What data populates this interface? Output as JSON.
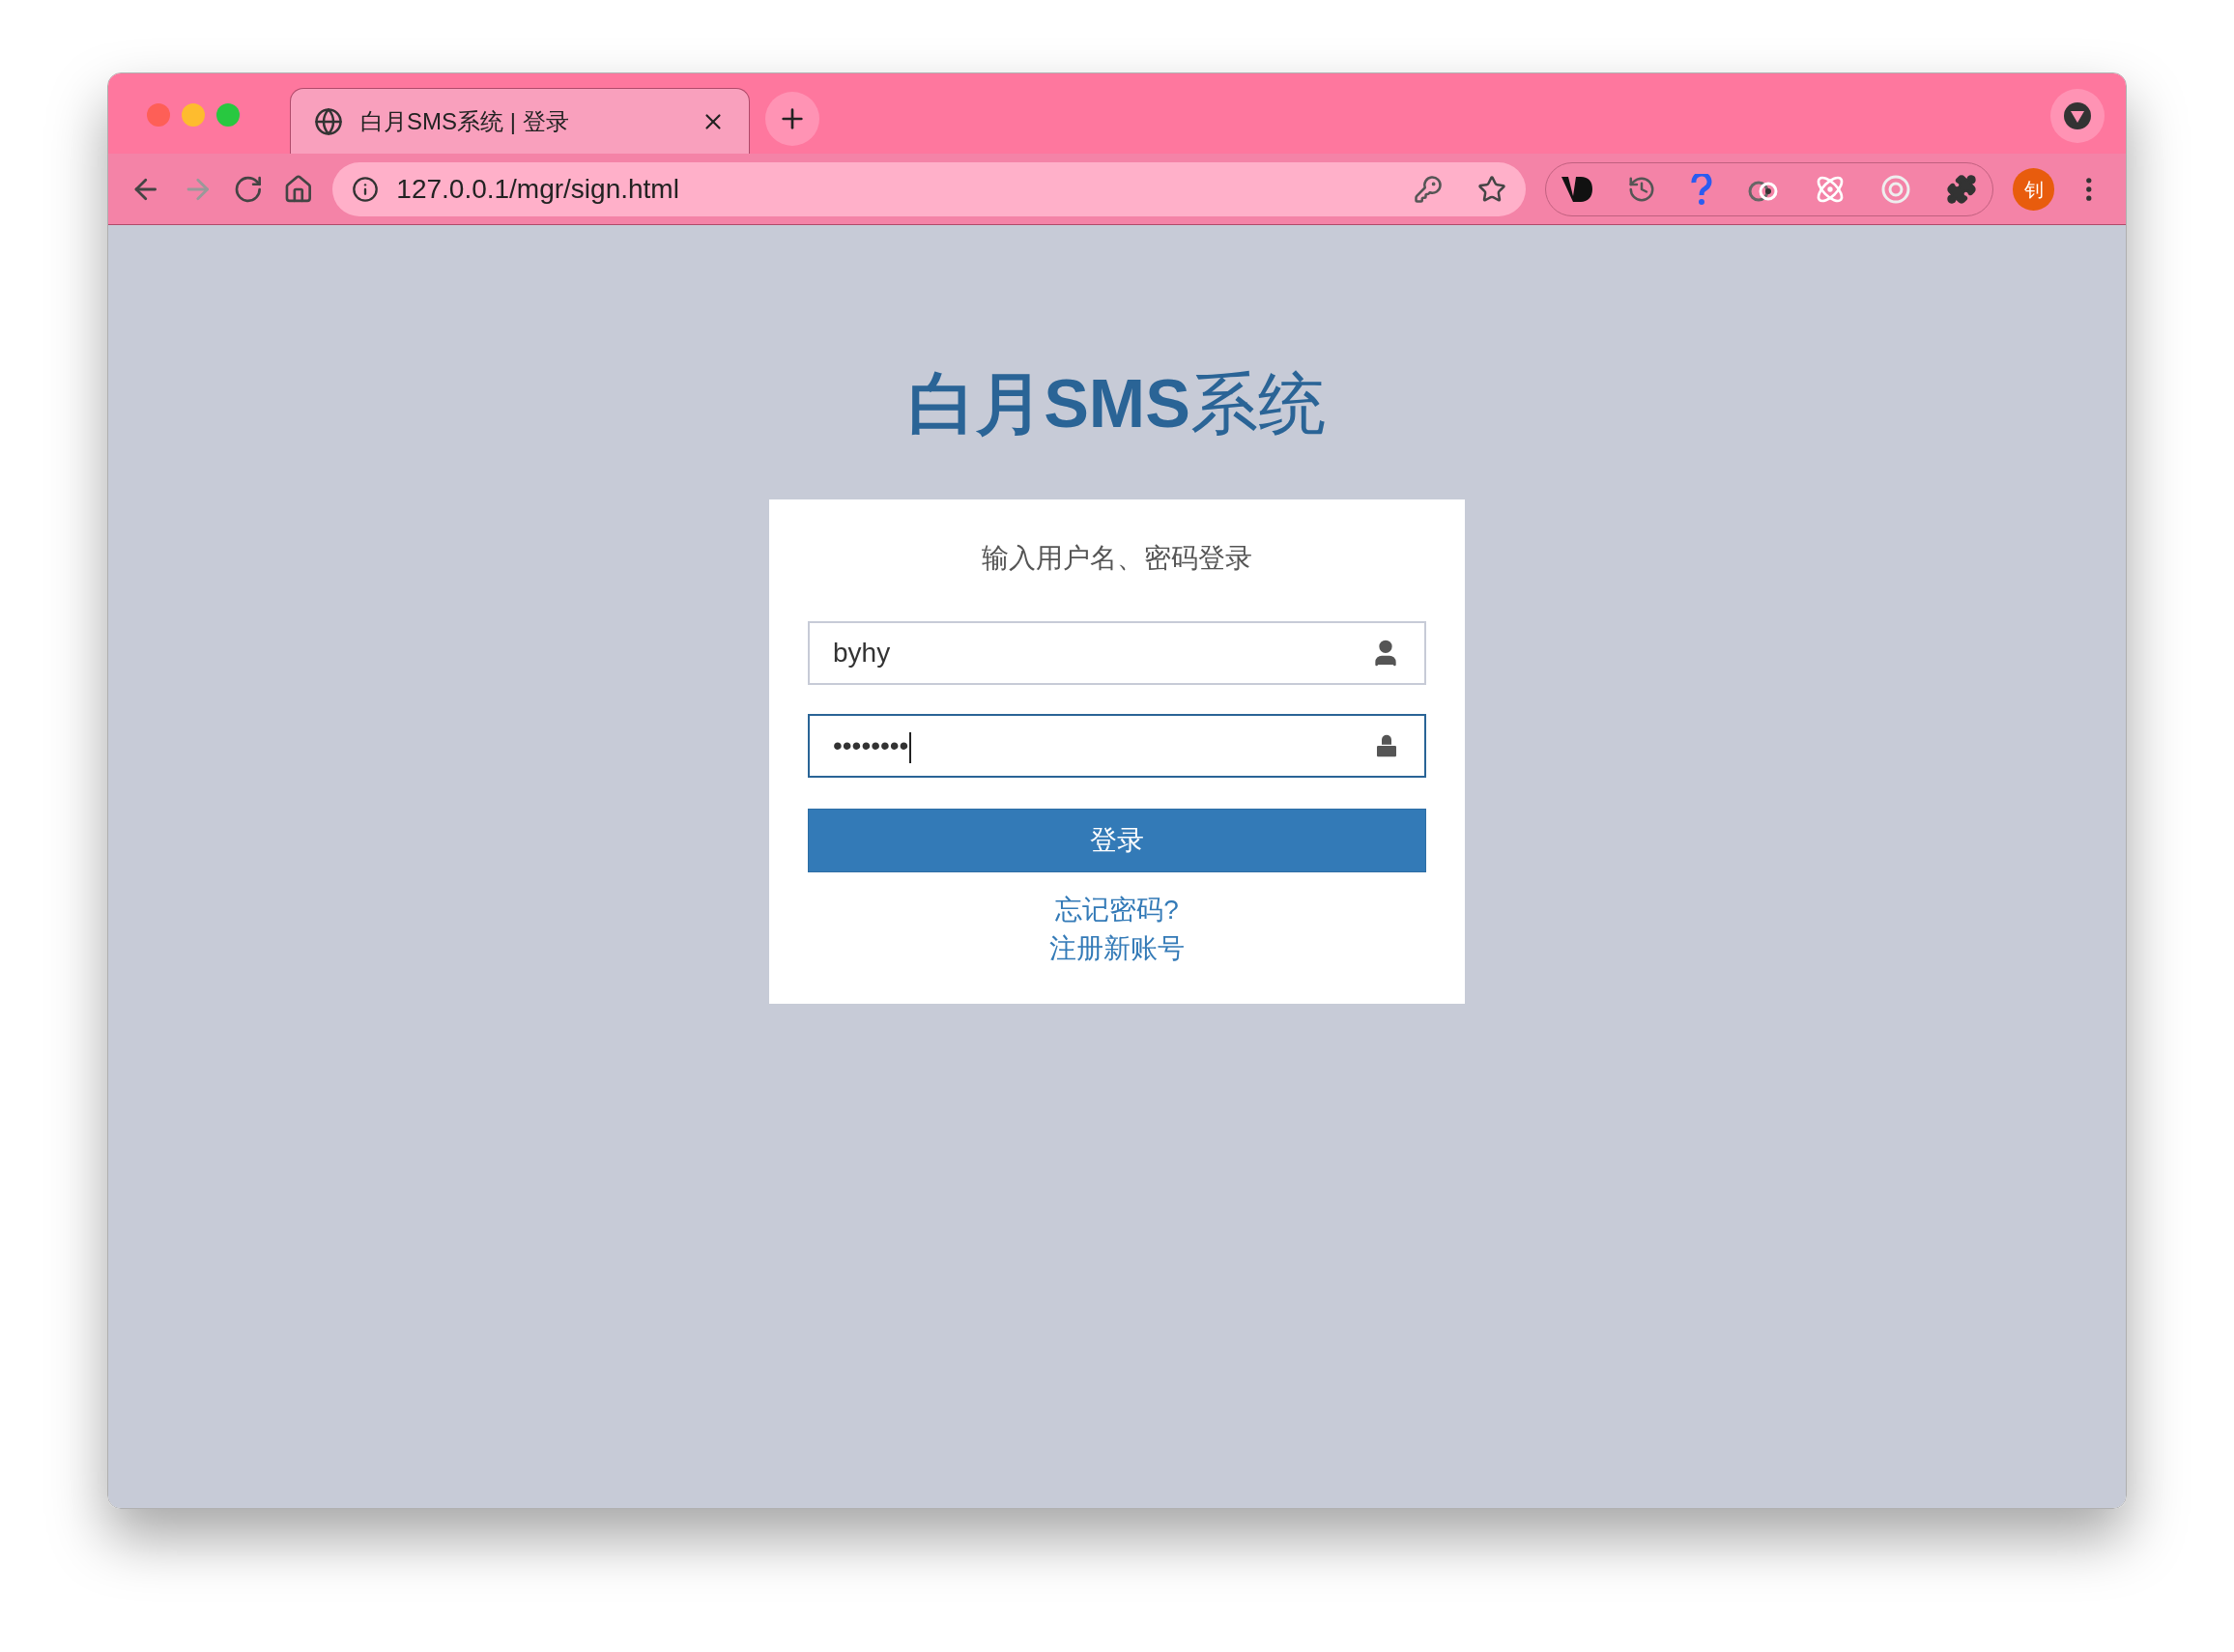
{
  "browser": {
    "tab": {
      "title": "白月SMS系统 | 登录",
      "selected": true
    },
    "address": "127.0.0.1/mgr/sign.html",
    "profile_initial": "钊"
  },
  "page": {
    "title": "**白月SMS**系统",
    "card": {
      "subtitle": "输入用户名、密码登录",
      "fields": [
        {
          "kind": "user",
          "value": "byhy",
          "focused": false
        },
        {
          "kind": "password",
          "value": "••••••••",
          "focused": true
        }
      ],
      "submit": "登录",
      "links": [
        "忘记密码?",
        "注册新账号"
      ]
    }
  }
}
